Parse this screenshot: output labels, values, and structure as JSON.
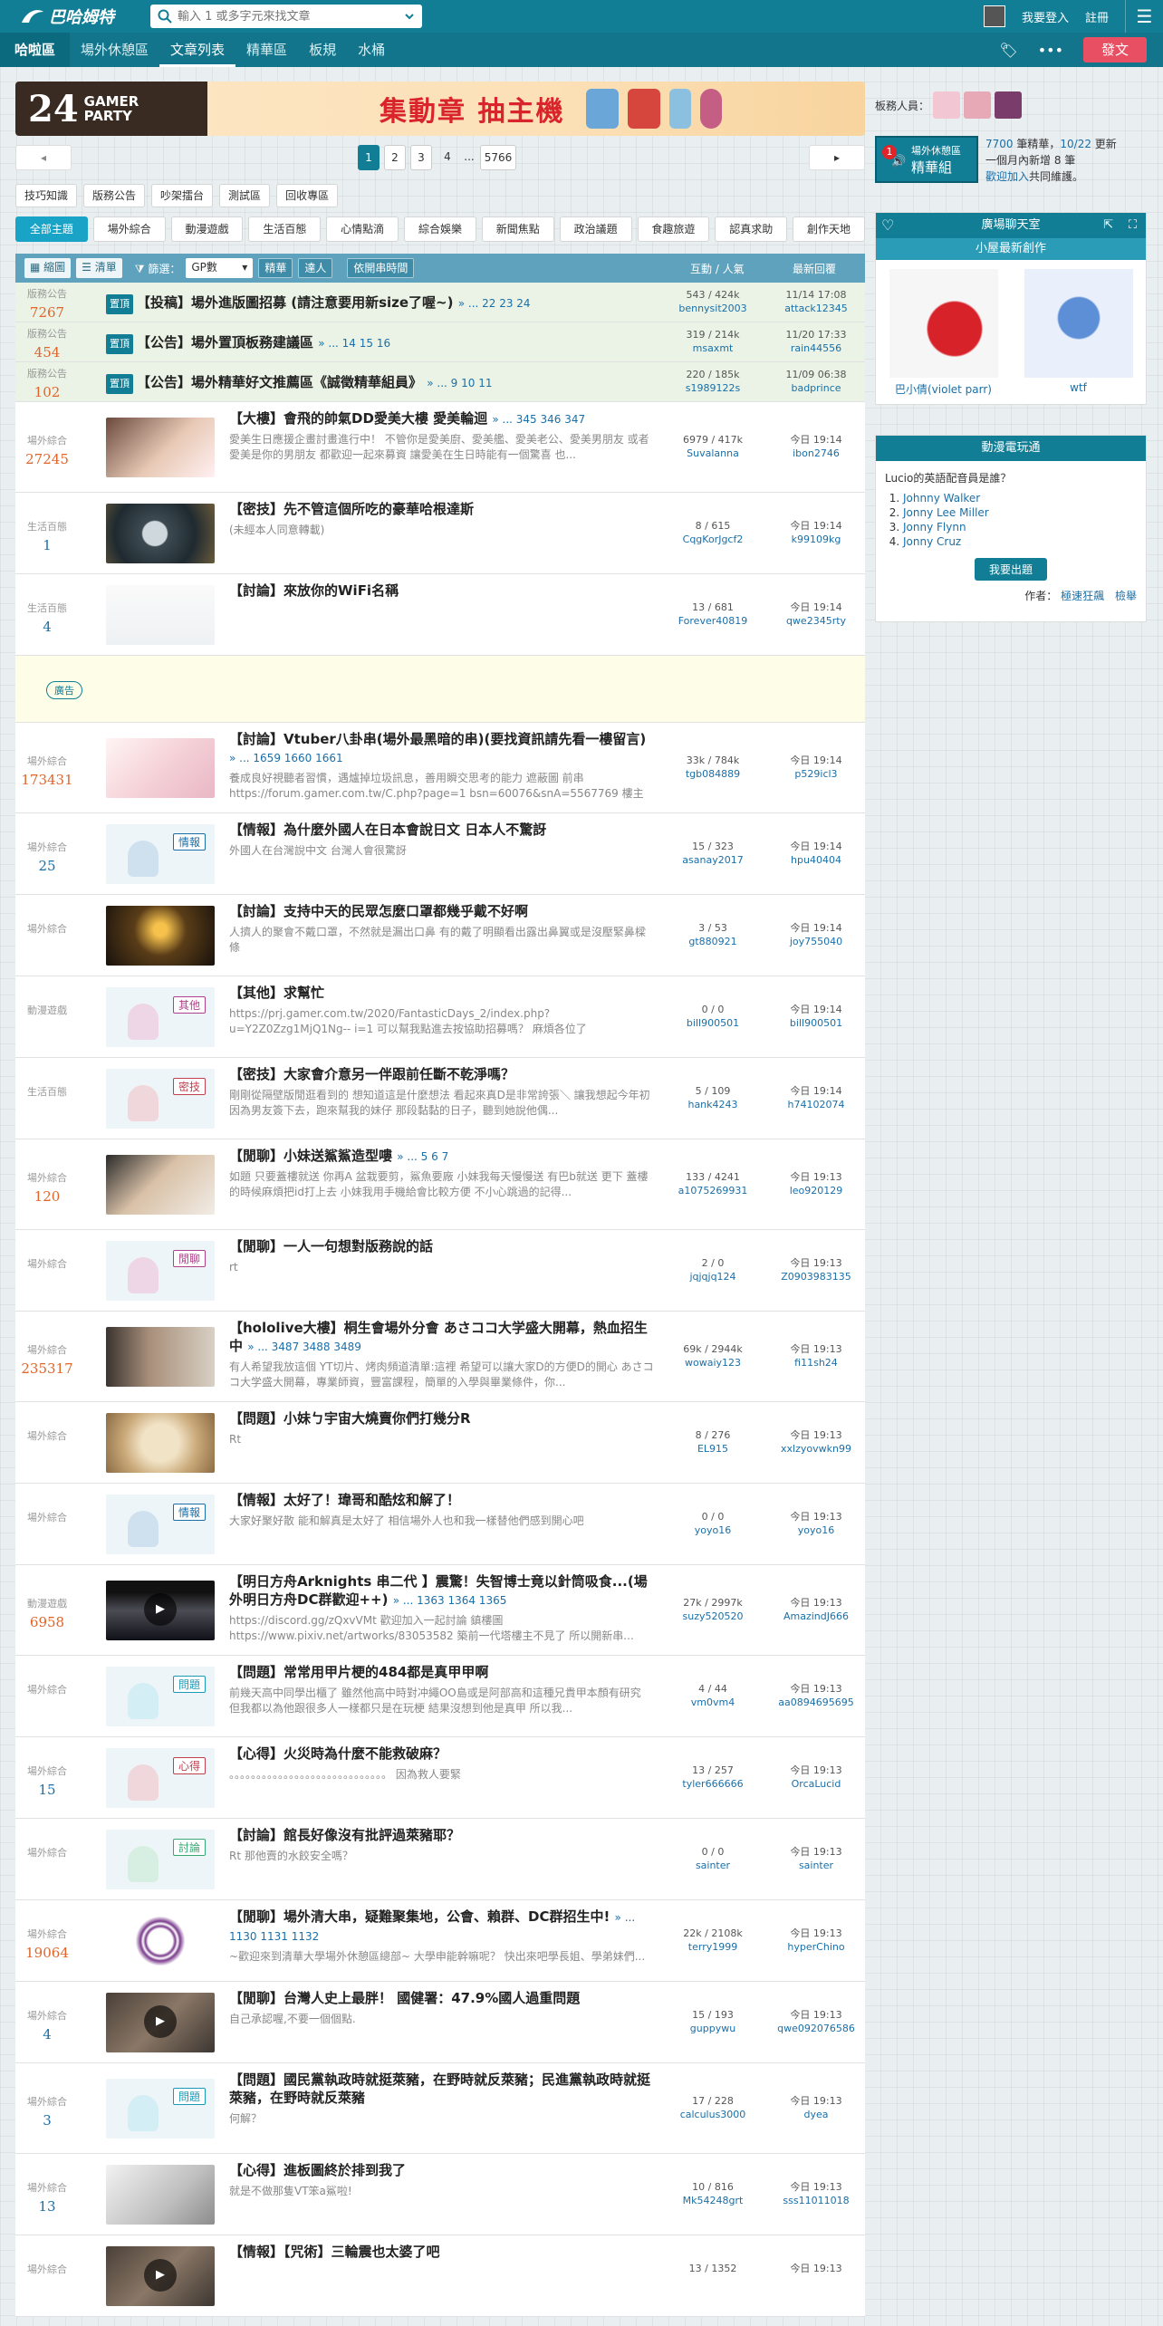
{
  "header": {
    "logo_text": "巴哈姆特",
    "search_placeholder": "輸入 1 或多字元來找文章",
    "login": "我要登入",
    "register": "註冊"
  },
  "nav": {
    "board": "哈啦區",
    "items": [
      "場外休憩區",
      "文章列表",
      "精華區",
      "板規",
      "水桶"
    ],
    "post": "發文"
  },
  "banner": {
    "num": "24",
    "line1": "GAMER",
    "line2": "PARTY",
    "slogan": "集動章 抽主機"
  },
  "pager": {
    "prev": "◂",
    "next": "▸",
    "pages": [
      "1",
      "2",
      "3",
      "4"
    ],
    "ellipsis": "...",
    "last": "5766"
  },
  "submenu": [
    "技巧知識",
    "版務公告",
    "吵架擂台",
    "測試區",
    "回收專區"
  ],
  "categories": [
    "全部主題",
    "場外綜合",
    "動漫遊戲",
    "生活百態",
    "心情點滴",
    "綜合娛樂",
    "新聞焦點",
    "政治議題",
    "食趣旅遊",
    "認真求助",
    "創作天地"
  ],
  "list_head": {
    "thumb": "縮圖",
    "text": "清單",
    "filter": "篩選：",
    "select": "GP數",
    "jh": "精華",
    "dr": "達人",
    "time": "依開串時間",
    "col_stat": "互動 / 人氣",
    "col_last": "最新回覆"
  },
  "rows": [
    {
      "type": "sticky",
      "cat": "版務公告",
      "gp": "7267",
      "tag": "置頂",
      "title": "【投稿】場外進版圖招募 (請注意要用新size了喔~)",
      "pages": "» ... 22  23  24",
      "desc": "",
      "stat": "543 / 424k",
      "author": "bennysit2003",
      "time": "11/14 17:08",
      "last": "attack12345"
    },
    {
      "type": "sticky",
      "cat": "版務公告",
      "gp": "454",
      "tag": "置頂",
      "title": "【公告】場外置頂板務建議區",
      "pages": "» ... 14  15  16",
      "desc": "",
      "stat": "319 / 214k",
      "author": "msaxmt",
      "time": "11/20 17:33",
      "last": "rain44556"
    },
    {
      "type": "sticky",
      "cat": "版務公告",
      "gp": "102",
      "tag": "置頂",
      "title": "【公告】場外精華好文推薦區《誠徵精華組員》",
      "pages": "» ... 9  10  11",
      "desc": "",
      "stat": "220 / 185k",
      "author": "s1989122s",
      "time": "11/09 06:38",
      "last": "badprince"
    },
    {
      "type": "post",
      "cat": "場外綜合",
      "gp": "27245",
      "gpc": "#e0652a",
      "thumb": "girl",
      "title": "【大樓】會飛的帥氣DD愛美大樓 愛美輪迴",
      "pages": "» ... 345  346  347",
      "desc": "愛美生日應援企畫討畫進行中！ 不管你是愛美廚、愛美艦、愛美老公、愛美男朋友 或者愛美是你的男朋友 都歡迎一起來募資 讓愛美在生日時能有一個驚喜 也...",
      "stat": "6979 / 417k",
      "author": "Suvalanna",
      "time": "今日 19:14",
      "last": "ibon2746"
    },
    {
      "type": "post",
      "cat": "生活百態",
      "gp": "1",
      "gpc": "#1a6fa8",
      "thumb": "watch",
      "title": "【密技】先不管這個所吃的豪華哈根達斯",
      "pages": "",
      "desc": "(未經本人同意轉載)",
      "stat": "8 / 615",
      "author": "CqgKorJgcf2",
      "time": "今日 19:14",
      "last": "k99109kg"
    },
    {
      "type": "post",
      "cat": "生活百態",
      "gp": "4",
      "gpc": "#1a6fa8",
      "thumb": "wifi",
      "title": "【討論】來放你的WiFi名稱",
      "pages": "",
      "desc": "",
      "stat": "13 / 681",
      "author": "Forever40819",
      "time": "今日 19:14",
      "last": "qwe2345rty"
    },
    {
      "type": "ad",
      "label": "廣告"
    },
    {
      "type": "post",
      "cat": "場外綜合",
      "gp": "173431",
      "gpc": "#e0652a",
      "thumb": "vtuber",
      "title": "【討論】Vtuber八卦串(場外最黑暗的串)(要找資訊請先看一樓留言)",
      "pages": "» ... 1659  1660  1661",
      "desc": "養成良好視聽者習慣，遇爐掉垃圾訊息，善用瞬交思考的能力 遮蔽圖 前串 https://forum.gamer.com.tw/C.php?page=1 bsn=60076&snA=5567769 樓主引...",
      "stat": "33k / 784k",
      "author": "tgb084889",
      "time": "今日 19:14",
      "last": "p529icl3"
    },
    {
      "type": "post",
      "cat": "場外綜合",
      "gp": "25",
      "gpc": "#1a6fa8",
      "thumb": "ph-info",
      "title": "【情報】為什麼外國人在日本會說日文 日本人不驚訝",
      "pages": "",
      "desc": "外國人在台灣說中文 台灣人會很驚訝",
      "stat": "15 / 323",
      "author": "asanay2017",
      "time": "今日 19:14",
      "last": "hpu40404"
    },
    {
      "type": "post",
      "cat": "場外綜合",
      "gp": "",
      "thumb": "crowd",
      "title": "【討論】支持中天的民眾怎麼口罩都幾乎戴不好啊",
      "pages": "",
      "desc": "人擠人的聚會不戴口罩，不然就是漏出口鼻 有的戴了明顯看出露出鼻翼或是沒壓緊鼻樑條",
      "stat": "3 / 53",
      "author": "gt880921",
      "time": "今日 19:14",
      "last": "joy755040"
    },
    {
      "type": "post",
      "cat": "動漫遊戲",
      "gp": "",
      "thumb": "ph-other",
      "title": "【其他】求幫忙",
      "pages": "",
      "desc": "https://prj.gamer.com.tw/2020/FantasticDays_2/index.php?u=Y2Z0Zzg1MjQ1Ng-- i=1 可以幫我點進去按協助招募嗎？ 麻煩各位了",
      "stat": "0 / 0",
      "author": "bill900501",
      "time": "今日 19:14",
      "last": "bill900501"
    },
    {
      "type": "post",
      "cat": "生活百態",
      "gp": "",
      "thumb": "ph-secret",
      "title": "【密技】大家會介意另一伴跟前任斷不乾淨嗎？",
      "pages": "",
      "desc": "剛剛從隔壁版閒逛看到的 想知道這是什麼想法 看起來真D是非常誇張＼ 讓我想起今年初因為男友簽下去，跑來幫我的妹仔 那段黏黏的日子，聽到她說他偶...",
      "stat": "5 / 109",
      "author": "hank4243",
      "time": "今日 19:14",
      "last": "h74102074"
    },
    {
      "type": "post",
      "cat": "場外綜合",
      "gp": "120",
      "gpc": "#e0652a",
      "thumb": "glasses",
      "title": "【閒聊】小妹送鯊鯊造型嘍",
      "pages": "» ... 5  6  7",
      "desc": "如題 只要蓋樓就送 你再A 盆栽要剪，鯊魚要廠 小妹我每天慢慢送 有巴b就送 更下 蓋樓的時候麻煩把id打上去 小妹我用手機給會比較方便 不小心跳過的記得...",
      "stat": "133 / 4241",
      "author": "a1075269931",
      "time": "今日 19:13",
      "last": "leo920129"
    },
    {
      "type": "post",
      "cat": "場外綜合",
      "gp": "",
      "thumb": "ph-chat",
      "title": "【閒聊】一人一句想對版務說的話",
      "pages": "",
      "desc": "rt",
      "stat": "2 / 0",
      "author": "jqjqjq124",
      "time": "今日 19:13",
      "last": "Z0903983135"
    },
    {
      "type": "post",
      "cat": "場外綜合",
      "gp": "235317",
      "gpc": "#e0652a",
      "thumb": "store",
      "title": "【hololive大樓】桐生會場外分會 あさココ大学盛大開幕，熱血招生中",
      "pages": "» ... 3487  3488  3489",
      "desc": "有人希望我放這個 YT切片、烤肉頻道清單:這裡 希望可以讓大家D的方便D的開心 あさココ大学盛大開幕，專業師資，豐富課程，簡單的入學與畢業條件，你...",
      "stat": "69k / 2944k",
      "author": "wowaiy123",
      "time": "今日 19:13",
      "last": "fi11sh24"
    },
    {
      "type": "post",
      "cat": "場外綜合",
      "gp": "",
      "thumb": "dumpling",
      "title": "【問題】小妹ㄅ宇宙大燒賣你們打幾分R",
      "pages": "",
      "desc": "Rt",
      "stat": "8 / 276",
      "author": "EL915",
      "time": "今日 19:13",
      "last": "xxlzyovwkn99"
    },
    {
      "type": "post",
      "cat": "場外綜合",
      "gp": "",
      "thumb": "ph-info",
      "title": "【情報】太好了！瑋哥和酷炫和解了！",
      "pages": "",
      "desc": "大家好聚好散 能和解真是太好了 相信場外人也和我一樣替他們感到開心吧",
      "stat": "0 / 0",
      "author": "yoyo16",
      "time": "今日 19:13",
      "last": "yoyo16"
    },
    {
      "type": "post",
      "cat": "動漫遊戲",
      "gp": "6958",
      "gpc": "#e0652a",
      "thumb": "game",
      "title": "【明日方舟Arknights 串二代 】震驚！失智博士竟以針筒吸食...(場外明日方舟DC群歡迎++)",
      "pages": "» ... 1363  1364  1365",
      "desc": "https://discord.gg/zQxvVMt 歡迎加入一起討論 鎮樓圖 https://www.pixiv.net/artworks/83053582 築前一代塔樓主不見了 所以開新串...",
      "stat": "27k / 2997k",
      "author": "suzy520520",
      "time": "今日 19:13",
      "last": "AmazindJ666"
    },
    {
      "type": "post",
      "cat": "場外綜合",
      "gp": "",
      "thumb": "ph-q",
      "title": "【問題】常常用甲片梗的484都是真甲甲啊",
      "pages": "",
      "desc": "前幾天高中同學出櫃了 雖然他高中時對冲繩OO島或是阿部高和這種兄貴甲本顏有研究 但我都以為他跟很多人一樣都只是在玩梗 結果沒想到他是真甲 所以我...",
      "stat": "4 / 44",
      "author": "vm0vm4",
      "time": "今日 19:13",
      "last": "aa0894695695"
    },
    {
      "type": "post",
      "cat": "場外綜合",
      "gp": "15",
      "gpc": "#1a6fa8",
      "thumb": "ph-heart",
      "title": "【心得】火災時為什麼不能救破麻？",
      "pages": "",
      "desc": "。。。。。。。。。。。。。。。。。。。。。。。。。。。。。 因為救人要緊",
      "stat": "13 / 257",
      "author": "tyler666666",
      "time": "今日 19:13",
      "last": "OrcaLucid"
    },
    {
      "type": "post",
      "cat": "場外綜合",
      "gp": "",
      "thumb": "ph-disc",
      "title": "【討論】館長好像沒有批評過萊豬耶？",
      "pages": "",
      "desc": "Rt 那他賣的水餃安全嗎？",
      "stat": "0 / 0",
      "author": "sainter",
      "time": "今日 19:13",
      "last": "sainter"
    },
    {
      "type": "post",
      "cat": "場外綜合",
      "gp": "19064",
      "gpc": "#e0652a",
      "thumb": "seal",
      "title": "【閒聊】場外清大串，疑難聚集地，公會、賴群、DC群招生中!",
      "pages": "» ... 1130  1131  1132",
      "desc": "~歡迎來到清華大學場外休憩區總部~ 大學申能幹嘛呢？ 快出來吧學長姐、學弟妹們...",
      "stat": "22k / 2108k",
      "author": "terry1999",
      "time": "今日 19:13",
      "last": "hyperChino"
    },
    {
      "type": "post",
      "cat": "場外綜合",
      "gp": "4",
      "gpc": "#1a6fa8",
      "thumb": "video",
      "title": "【閒聊】台灣人史上最胖！ 國健署：47.9%國人過重問題",
      "pages": "",
      "desc": "自己承認喔,不要一個個點.",
      "stat": "15 / 193",
      "author": "guppywu",
      "time": "今日 19:13",
      "last": "qwe092076586"
    },
    {
      "type": "post",
      "cat": "場外綜合",
      "gp": "3",
      "gpc": "#1a6fa8",
      "thumb": "ph-q",
      "title": "【問題】國民黨執政時就挺萊豬，在野時就反萊豬；民進黨執政時就挺萊豬，在野時就反萊豬",
      "pages": "",
      "desc": "何解？",
      "stat": "17 / 228",
      "author": "calculus3000",
      "time": "今日 19:13",
      "last": "dyea"
    },
    {
      "type": "post",
      "cat": "場外綜合",
      "gp": "13",
      "gpc": "#1a6fa8",
      "thumb": "manga",
      "title": "【心得】進板圖終於排到我了",
      "pages": "",
      "desc": "就是不做那隻VT笨a鯊啦!",
      "stat": "10 / 816",
      "author": "Mk54248grt",
      "time": "今日 19:13",
      "last": "sss11011018"
    },
    {
      "type": "post",
      "cat": "場外綜合",
      "gp": "",
      "thumb": "video",
      "title": "【情報】【咒術】三輪震也太婆了吧",
      "pages": "",
      "desc": "",
      "stat": "13 / 1352",
      "author": "",
      "time": "今日 19:13",
      "last": ""
    }
  ],
  "sidebar": {
    "mods_label": "板務人員：",
    "promo_title": "場外休憩區",
    "promo_sub": "精華組",
    "promo_badge": "1",
    "stats_a": "7700",
    "stats_b": " 筆精華，",
    "stats_c": "10/22",
    "stats_d": " 更新",
    "stats_e": "一個月內新增 8 筆",
    "stats_f": "歡迎加入",
    "stats_g": "共同維護。",
    "chat_title": "廣場聊天室",
    "creation_title": "小屋最新創作",
    "works": [
      {
        "name": "巴小倩(violet parr)"
      },
      {
        "name": "wtf"
      }
    ],
    "quiz_title": "動漫電玩通",
    "quiz_q": "Lucio的英語配音員是誰？",
    "quiz_options": [
      "Johnny Walker",
      "Jonny Lee Miller",
      "Jonny Flynn",
      "Jonny Cruz"
    ],
    "quiz_btn": "我要出題",
    "quiz_author_label": "作者：",
    "quiz_author": "極速狂飆",
    "quiz_report": "檢舉"
  }
}
